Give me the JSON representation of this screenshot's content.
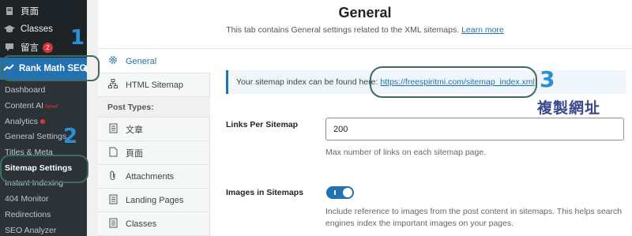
{
  "wp_menu": {
    "items": [
      {
        "label": "頁面",
        "icon": "pages-icon"
      },
      {
        "label": "Classes",
        "icon": "graduation-cap-icon"
      },
      {
        "label": "留言",
        "icon": "comment-icon",
        "badge": "2"
      }
    ],
    "active": {
      "label": "Rank Math SEO",
      "icon": "rank-math-icon"
    },
    "submenu": [
      {
        "label": "Dashboard"
      },
      {
        "label": "Content AI",
        "tag": "New!"
      },
      {
        "label": "Analytics",
        "dot": true
      },
      {
        "label": "General Settings"
      },
      {
        "label": "Titles & Meta"
      },
      {
        "label": "Sitemap Settings",
        "current": true
      },
      {
        "label": "Instant Indexing"
      },
      {
        "label": "404 Monitor"
      },
      {
        "label": "Redirections"
      },
      {
        "label": "SEO Analyzer"
      }
    ]
  },
  "page": {
    "title": "General",
    "description": "This tab contains General settings related to the XML sitemaps.",
    "learn_more": "Learn more"
  },
  "tabs": {
    "items": [
      {
        "label": "General",
        "icon": "gear-icon",
        "active": true
      },
      {
        "label": "HTML Sitemap",
        "icon": "sitemap-icon"
      }
    ],
    "post_types_heading": "Post Types:",
    "post_types": [
      {
        "label": "文章",
        "icon": "document-icon"
      },
      {
        "label": "頁面",
        "icon": "page-icon"
      },
      {
        "label": "Attachments",
        "icon": "paperclip-icon"
      },
      {
        "label": "Landing Pages",
        "icon": "document-icon"
      },
      {
        "label": "Classes",
        "icon": "document-icon"
      }
    ]
  },
  "notice": {
    "text": "Your sitemap index can be found here:",
    "link": "https://freespiritmi.com/sitemap_index.xml"
  },
  "fields": {
    "links_per_sitemap": {
      "label": "Links Per Sitemap",
      "value": "200",
      "description": "Max number of links on each sitemap page."
    },
    "images_in_sitemaps": {
      "label": "Images in Sitemaps",
      "enabled": true,
      "description_line1": "Include reference to images from the post content in sitemaps. This helps search",
      "description_line2": "engines index the important images on your pages."
    }
  },
  "annotations": {
    "step1": "1",
    "step2": "2",
    "step3": "3",
    "step3_text": "複製網址"
  },
  "colors": {
    "accent": "#2271b1",
    "sidebar_bg": "#1d2327",
    "annotation_number": "#2b8fd6",
    "annotation_outline": "#3f6b5c",
    "badge_red": "#d63638"
  }
}
